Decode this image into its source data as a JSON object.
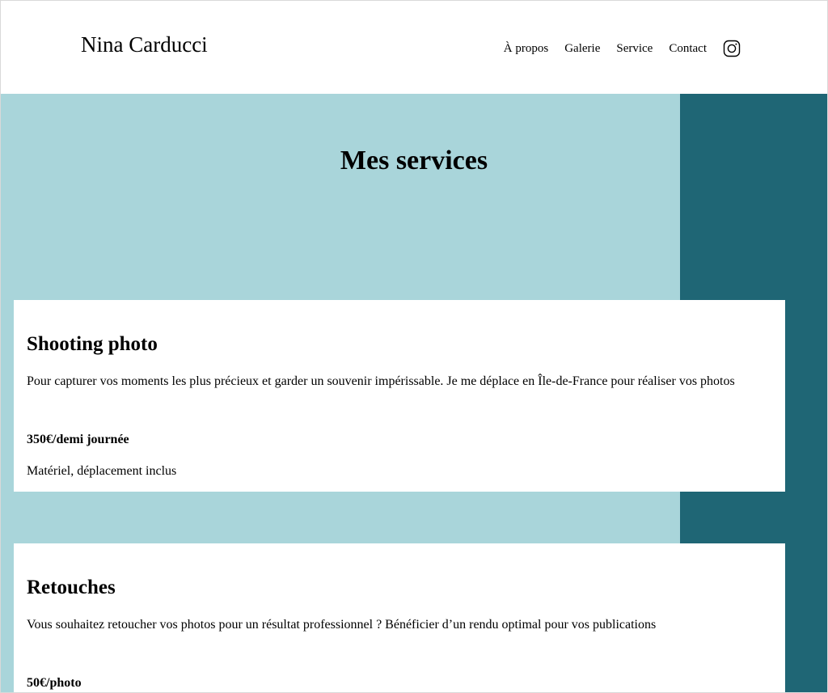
{
  "header": {
    "brand": "Nina Carducci",
    "nav": [
      {
        "label": "À propos"
      },
      {
        "label": "Galerie"
      },
      {
        "label": "Service"
      },
      {
        "label": "Contact"
      }
    ],
    "social_icon": "instagram-icon"
  },
  "main": {
    "title": "Mes services",
    "services": [
      {
        "title": "Shooting photo",
        "description": "Pour capturer vos moments les plus précieux et garder un souvenir impérissable. Je me déplace en Île-de-France pour réaliser vos photos",
        "price": "350€/demi journée",
        "note": "Matériel, déplacement inclus"
      },
      {
        "title": "Retouches",
        "description": "Vous souhaitez retoucher vos photos pour un résultat professionnel ? Bénéficier d’un rendu optimal pour vos publications",
        "price": "50€/photo"
      }
    ]
  },
  "colors": {
    "light_band": "#a9d5da",
    "dark_teal": "#1f6675",
    "card": "#ffffff"
  }
}
